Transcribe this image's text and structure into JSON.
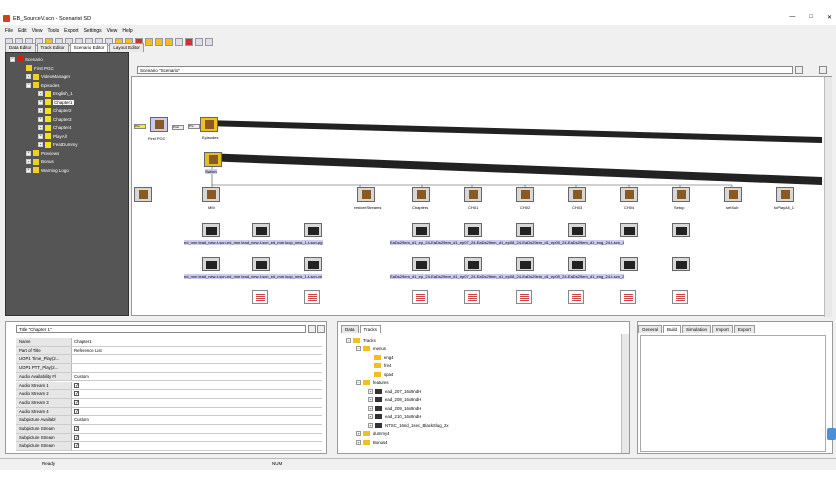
{
  "window": {
    "title": "EB_SourceV.scn - Scenarist SD"
  },
  "menu": [
    "File",
    "Edit",
    "View",
    "Tools",
    "Export",
    "Settings",
    "View",
    "Help"
  ],
  "editor_tabs": [
    "Data Editor",
    "Track Editor",
    "Scenario Editor",
    "Layout Editor"
  ],
  "tree": {
    "root": "Scenario",
    "items": [
      {
        "label": "First PGC",
        "level": 1
      },
      {
        "label": "VideoManager",
        "level": 1
      },
      {
        "label": "Episodes",
        "level": 1
      },
      {
        "label": "English_1",
        "level": 2
      },
      {
        "label": "Chapter1",
        "level": 2,
        "selected": true
      },
      {
        "label": "Chapter2",
        "level": 2
      },
      {
        "label": "Chapter3",
        "level": 2
      },
      {
        "label": "Chapter4",
        "level": 2
      },
      {
        "label": "PlayAll",
        "level": 2
      },
      {
        "label": "FeatDummy",
        "level": 2
      },
      {
        "label": "Previews",
        "level": 1
      },
      {
        "label": "Bonus",
        "level": 1
      },
      {
        "label": "Warning Logo",
        "level": 1
      }
    ]
  },
  "graph": {
    "combo": "Scenario \"Scenario\"",
    "first_pgc": "First PGC",
    "episodes": "Episodes",
    "switch": "Switch",
    "row1": [
      "MM",
      "restoreStreams",
      "Chapters",
      "CH01",
      "CH02",
      "CH03",
      "CH04",
      "Setup",
      "setSub",
      "toPlayAll_1"
    ],
    "row2_labels": [
      "ed_mm lead_new-t-scn-ed_mm lead_new-t-scn_ed_mm loop_new_1-t-scn-pg",
      "EaDs29em_d1_ep_24-EaDs29em_d1_ep07_24-EaDs29em_d1_ep08_24-EaDs29em_d1_ep09_24-EaDs29em_d1_eng_24-t-scn_1"
    ],
    "row3_labels": [
      "ed_mm lead_new-t-scn-ed_mm lead_new-t-scn_ed_mm loop_new_1-t-scn-ve",
      "EaDs29em_d1_ep_24-EaDs29em_d1_ep07_24-EaDs29em_d1_ep08_24-EaDs29em_d1_ep09_24-EaDs29em_d1_eng_24-t-scn_2"
    ]
  },
  "props": {
    "combo": "Title \"Chapter 1\"",
    "rows": [
      {
        "name": "Name",
        "value": "Chapter1"
      },
      {
        "name": "Part of Title",
        "value": "Reference List"
      },
      {
        "name": "UOP1 Time_Play(2...",
        "value": ""
      },
      {
        "name": "UOP1 PTT_Play(2...",
        "value": ""
      },
      {
        "name": "Audio Availability Fl",
        "value": "Custom"
      },
      {
        "name": "Audio Stream 1",
        "value": "check"
      },
      {
        "name": "Audio Stream 2",
        "value": "check"
      },
      {
        "name": "Audio Stream 3",
        "value": "check"
      },
      {
        "name": "Audio Stream 4",
        "value": "check"
      },
      {
        "name": "Subpicture Availabl",
        "value": "Custom"
      },
      {
        "name": "Subpicture Stream",
        "value": "check"
      },
      {
        "name": "Subpicture Stream",
        "value": "check"
      },
      {
        "name": "Subpicture Stream",
        "value": "check"
      }
    ]
  },
  "tracks": {
    "tabs": [
      "Data",
      "Tracks"
    ],
    "items": [
      {
        "label": "Tracks",
        "type": "fold",
        "level": 0
      },
      {
        "label": "menus",
        "type": "fold",
        "level": 1
      },
      {
        "label": "eng4",
        "type": "fold",
        "level": 2
      },
      {
        "label": "fre4",
        "type": "fold",
        "level": 2
      },
      {
        "label": "spa4",
        "type": "fold",
        "level": 2
      },
      {
        "label": "features",
        "type": "fold",
        "level": 1
      },
      {
        "label": "ead_207_16x9ndH",
        "type": "film",
        "level": 2
      },
      {
        "label": "ead_208_16x9ndH",
        "type": "film",
        "level": 2
      },
      {
        "label": "ead_209_16x9ndH",
        "type": "film",
        "level": 2
      },
      {
        "label": "ead_210_16x9ndH",
        "type": "film",
        "level": 2
      },
      {
        "label": "NTSC_16nd_1sec_BlackSlug_2x",
        "type": "film",
        "level": 2
      },
      {
        "label": "dummy4",
        "type": "fold",
        "level": 1
      },
      {
        "label": "Bonus4",
        "type": "fold",
        "level": 1
      }
    ]
  },
  "right_tabs": [
    "General",
    "Build",
    "Simulation",
    "Import",
    "Export"
  ],
  "status": {
    "ready": "Ready",
    "num": "NUM"
  }
}
